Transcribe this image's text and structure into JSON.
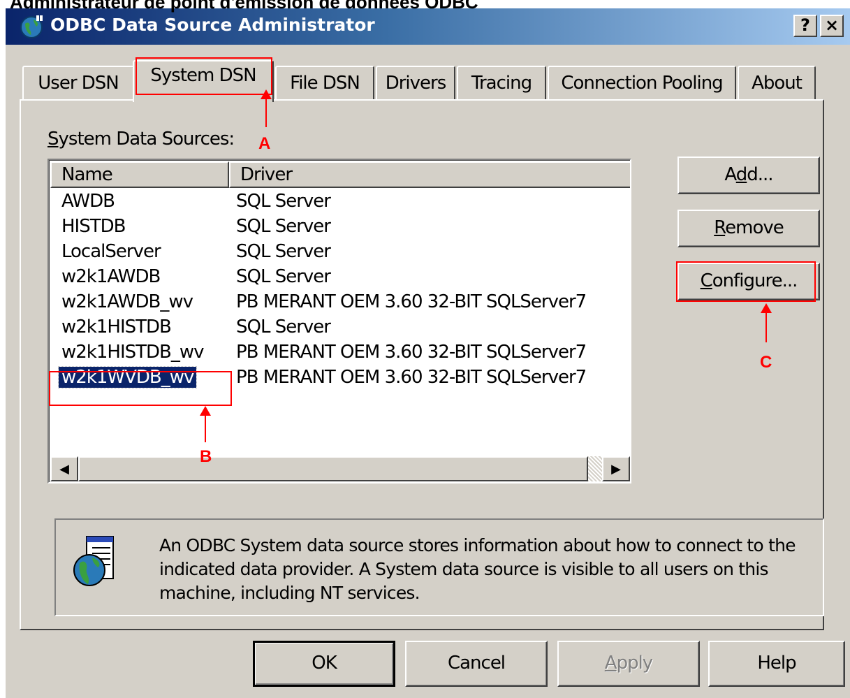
{
  "page_caption": "Administrateur de point d'émission de données ODBC",
  "window": {
    "title": "ODBC Data Source Administrator",
    "help_button": "?",
    "close_button": "×",
    "icon": "odbc-globe-icon"
  },
  "tabs": [
    {
      "label": "User DSN"
    },
    {
      "label": "System DSN",
      "active": true
    },
    {
      "label": "File DSN"
    },
    {
      "label": "Drivers"
    },
    {
      "label": "Tracing"
    },
    {
      "label": "Connection Pooling"
    },
    {
      "label": "About"
    }
  ],
  "system_data_sources_label": {
    "accel": "S",
    "rest": "ystem Data Sources:"
  },
  "list": {
    "columns": [
      "Name",
      "Driver"
    ],
    "rows": [
      {
        "name": "AWDB",
        "driver": "SQL Server"
      },
      {
        "name": "HISTDB",
        "driver": "SQL Server"
      },
      {
        "name": "LocalServer",
        "driver": "SQL Server"
      },
      {
        "name": "w2k1AWDB",
        "driver": "SQL Server"
      },
      {
        "name": "w2k1AWDB_wv",
        "driver": "PB MERANT OEM 3.60 32-BIT SQLServer7"
      },
      {
        "name": "w2k1HISTDB",
        "driver": "SQL Server"
      },
      {
        "name": "w2k1HISTDB_wv",
        "driver": "PB MERANT OEM 3.60 32-BIT SQLServer7"
      },
      {
        "name": "w2k1WVDB_wv",
        "driver": "PB MERANT OEM 3.60 32-BIT SQLServer7",
        "selected": true
      }
    ],
    "scroll_left": "◀",
    "scroll_right": "▶"
  },
  "side_buttons": {
    "add": {
      "pre": "A",
      "accel": "d",
      "post": "d..."
    },
    "remove": {
      "pre": "",
      "accel": "R",
      "post": "emove"
    },
    "configure": {
      "pre": "",
      "accel": "C",
      "post": "onfigure..."
    }
  },
  "info_text": "An ODBC System data source stores information about how to connect to the indicated data provider.   A System data source is visible to all users on this machine, including NT services.",
  "bottom_buttons": {
    "ok": "OK",
    "cancel": "Cancel",
    "apply": {
      "accel": "A",
      "rest": "pply"
    },
    "help": "Help"
  },
  "annotations": {
    "a": "A",
    "b": "B",
    "c": "C"
  },
  "colors": {
    "annotation": "#ff0000",
    "titlebar": "#0a246a",
    "selection": "#0a246a",
    "dialog": "#d4d0c8"
  }
}
